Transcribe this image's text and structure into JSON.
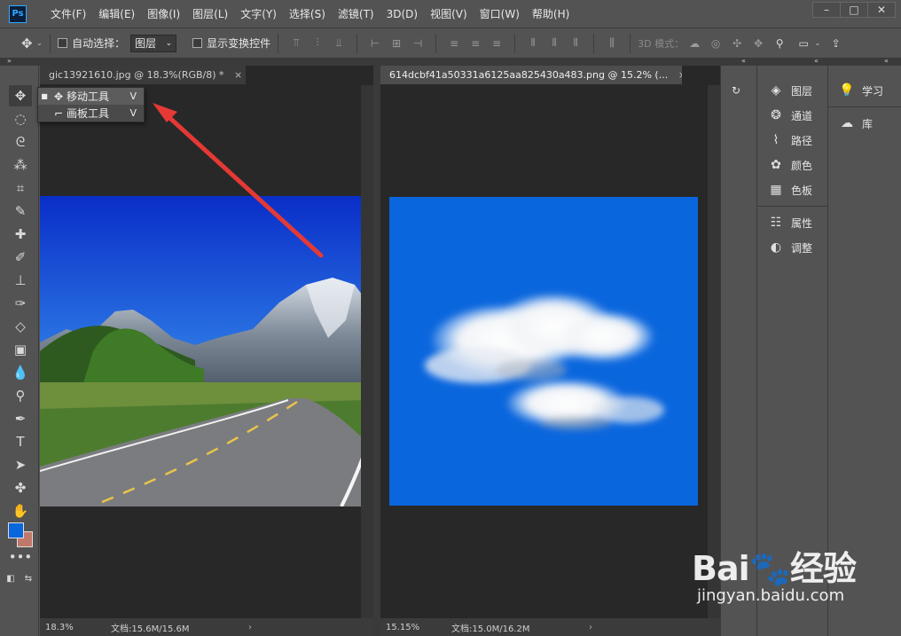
{
  "menubar": {
    "logo": "Ps",
    "items": [
      "文件(F)",
      "编辑(E)",
      "图像(I)",
      "图层(L)",
      "文字(Y)",
      "选择(S)",
      "滤镜(T)",
      "3D(D)",
      "视图(V)",
      "窗口(W)",
      "帮助(H)"
    ]
  },
  "optbar": {
    "auto_select_label": "自动选择：",
    "auto_select_value": "图层",
    "show_transform_label": "显示变换控件",
    "mode_3d_label": "3D 模式："
  },
  "tabs": {
    "left": {
      "title": "gic13921610.jpg @ 18.3%(RGB/8) *",
      "close": "×"
    },
    "right": {
      "title": "614dcbf41a50331a6125aa825430a483.png @ 15.2% (...",
      "close": "×"
    }
  },
  "status": {
    "left": {
      "zoom": "18.3%",
      "doc": "文档:15.6M/15.6M",
      "more": "›"
    },
    "right": {
      "zoom": "15.15%",
      "doc": "文档:15.0M/16.2M",
      "more": "›"
    }
  },
  "flyout": {
    "items": [
      {
        "label": "移动工具",
        "key": "V",
        "icon": "move-icon",
        "selected": true
      },
      {
        "label": "画板工具",
        "key": "V",
        "icon": "artboard-icon",
        "selected": false
      }
    ]
  },
  "panels": {
    "col2": [
      "图层",
      "通道",
      "路径",
      "颜色",
      "色板",
      "属性",
      "调整"
    ],
    "col3": [
      "学习",
      "库"
    ]
  },
  "colors": {
    "foreground": "#0a66dd",
    "background": "#c0786a",
    "arrow": "#e53935"
  },
  "watermark": {
    "brand": "Bai",
    "brand_suffix": "经验",
    "url": "jingyan.baidu.com"
  }
}
